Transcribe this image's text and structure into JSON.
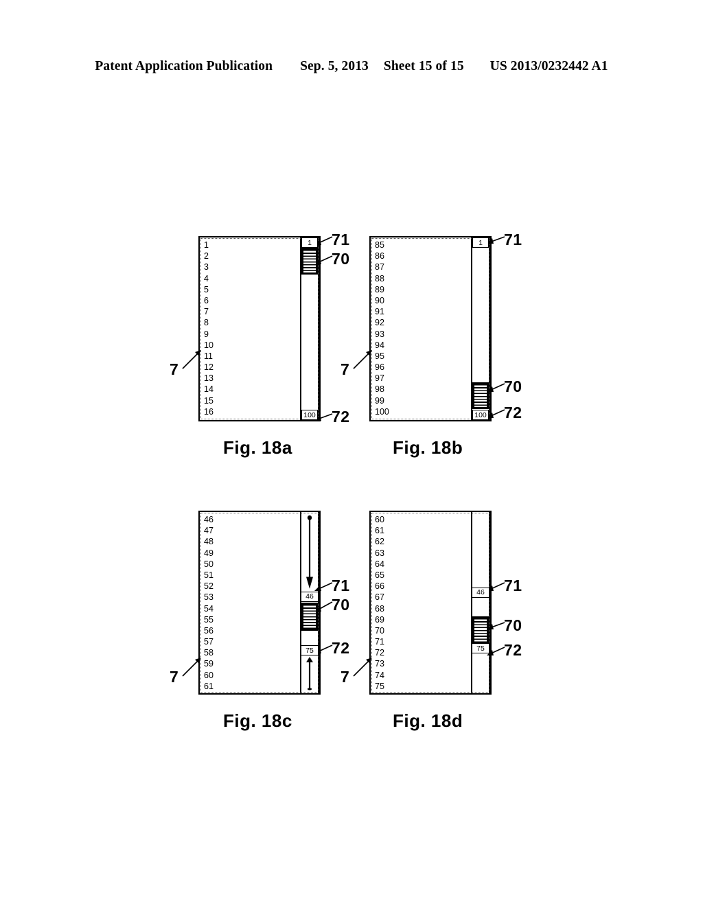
{
  "header": {
    "publication": "Patent Application Publication",
    "date": "Sep. 5, 2013",
    "sheet": "Sheet 15 of 15",
    "patent_number": "US 2013/0232442 A1"
  },
  "reference_numerals": {
    "window": "7",
    "scroll_thumb": "70",
    "top_marker": "71",
    "bottom_marker": "72"
  },
  "figures": [
    {
      "id": "18a",
      "caption": "Fig. 18a",
      "items": [
        "1",
        "2",
        "3",
        "4",
        "5",
        "6",
        "7",
        "8",
        "9",
        "10",
        "11",
        "12",
        "13",
        "14",
        "15",
        "16"
      ],
      "scrollbar": {
        "top_value": "1",
        "bottom_value": "100",
        "thumb_top_pct": 5.8,
        "thumb_height_pct": 14.5,
        "has_travel_arrows": false,
        "markers_floating": false
      }
    },
    {
      "id": "18b",
      "caption": "Fig. 18b",
      "items": [
        "85",
        "86",
        "87",
        "88",
        "89",
        "90",
        "91",
        "92",
        "93",
        "94",
        "95",
        "96",
        "97",
        "98",
        "99",
        "100"
      ],
      "scrollbar": {
        "top_value": "1",
        "bottom_value": "100",
        "thumb_top_pct": 79.5,
        "thumb_height_pct": 14.5,
        "has_travel_arrows": false,
        "markers_floating": false
      }
    },
    {
      "id": "18c",
      "caption": "Fig. 18c",
      "items": [
        "46",
        "47",
        "48",
        "49",
        "50",
        "51",
        "52",
        "53",
        "54",
        "55",
        "56",
        "57",
        "58",
        "59",
        "60",
        "61"
      ],
      "scrollbar": {
        "top_value": "46",
        "bottom_value": "75",
        "thumb_top_pct": 50.0,
        "thumb_height_pct": 15.5,
        "marker_top_pct": 43.8,
        "marker_bottom_pct": 73.5,
        "has_travel_arrows": true,
        "markers_floating": true
      }
    },
    {
      "id": "18d",
      "caption": "Fig. 18d",
      "items": [
        "60",
        "61",
        "62",
        "63",
        "64",
        "65",
        "66",
        "67",
        "68",
        "69",
        "70",
        "71",
        "72",
        "73",
        "74",
        "75"
      ],
      "scrollbar": {
        "top_value": "46",
        "bottom_value": "75",
        "thumb_top_pct": 57.5,
        "thumb_height_pct": 15.5,
        "marker_top_pct": 41.5,
        "marker_bottom_pct": 72.5,
        "has_travel_arrows": false,
        "markers_floating": true
      }
    }
  ]
}
